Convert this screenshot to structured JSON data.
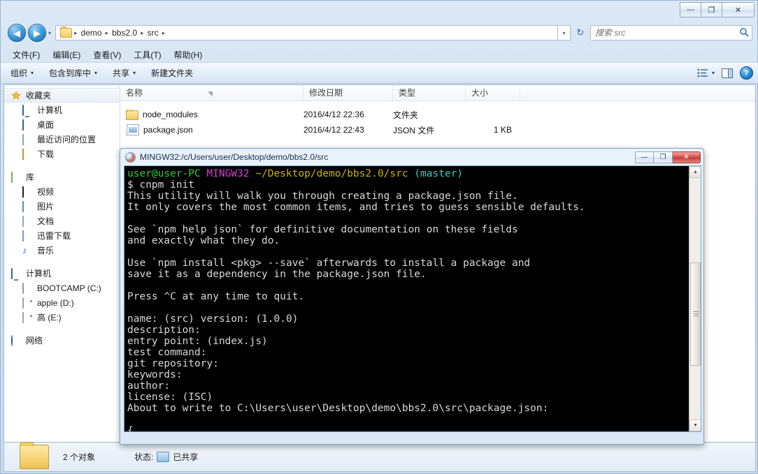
{
  "window": {
    "controls": {
      "minimize": "—",
      "maximize": "❐",
      "close": "✕"
    }
  },
  "address_bar": {
    "back_label": "◀",
    "forward_label": "▶",
    "history_dropdown": "▾",
    "breadcrumbs": [
      "demo",
      "bbs2.0",
      "src"
    ],
    "separator": "▸",
    "path_dropdown": "▾",
    "refresh_label": "↻"
  },
  "search": {
    "placeholder": "搜索 src",
    "value": "",
    "icon": "search-icon"
  },
  "menu": {
    "items": [
      "文件(F)",
      "编辑(E)",
      "查看(V)",
      "工具(T)",
      "帮助(H)"
    ]
  },
  "toolbar": {
    "items": [
      {
        "label": "组织",
        "caret": "▾"
      },
      {
        "label": "包含到库中",
        "caret": "▾"
      },
      {
        "label": "共享",
        "caret": "▾"
      },
      {
        "label": "新建文件夹",
        "caret": ""
      }
    ],
    "view_caret": "▾",
    "help_label": "?"
  },
  "nav_pane": {
    "groups": [
      {
        "header": {
          "label": "收藏夹",
          "icon": "star-icon",
          "selected": true
        },
        "items": [
          {
            "label": "计算机",
            "icon": "computer-icon"
          },
          {
            "label": "桌面",
            "icon": "desktop-icon"
          },
          {
            "label": "最近访问的位置",
            "icon": "recent-places-icon"
          },
          {
            "label": "下载",
            "icon": "downloads-icon"
          }
        ]
      },
      {
        "header": {
          "label": "库",
          "icon": "library-icon",
          "selected": false
        },
        "items": [
          {
            "label": "视频",
            "icon": "video-icon"
          },
          {
            "label": "图片",
            "icon": "pictures-icon"
          },
          {
            "label": "文档",
            "icon": "documents-icon"
          },
          {
            "label": "迅雷下载",
            "icon": "thunder-download-icon"
          },
          {
            "label": "音乐",
            "icon": "music-icon"
          }
        ]
      },
      {
        "header": {
          "label": "计算机",
          "icon": "computer-icon",
          "selected": false
        },
        "items": [
          {
            "label": "BOOTCAMP (C:)",
            "icon": "hard-drive-icon"
          },
          {
            "label": "apple (D:)",
            "icon": "drive-icon"
          },
          {
            "label": "高 (E:)",
            "icon": "drive-icon"
          }
        ]
      },
      {
        "header": {
          "label": "网络",
          "icon": "network-icon",
          "selected": false
        },
        "items": []
      }
    ]
  },
  "file_list": {
    "columns": [
      "名称",
      "修改日期",
      "类型",
      "大小"
    ],
    "rows": [
      {
        "name": "node_modules",
        "date": "2016/4/12 22:36",
        "type": "文件夹",
        "size": "",
        "icon": "folder-icon"
      },
      {
        "name": "package.json",
        "date": "2016/4/12 22:43",
        "type": "JSON 文件",
        "size": "1 KB",
        "icon": "json-file-icon"
      }
    ]
  },
  "details_pane": {
    "object_count": "2 个对象",
    "status_label": "状态:",
    "status_value": "已共享"
  },
  "terminal": {
    "title": "MINGW32:/c/Users/user/Desktop/demo/bbs2.0/src",
    "controls": {
      "minimize": "—",
      "maximize": "❐",
      "close": "✕"
    },
    "prompt": {
      "user": "user@user-PC",
      "shell": "MINGW32",
      "path": "~/Desktop/demo/bbs2.0/src",
      "branch": "(master)"
    },
    "lines": [
      "$ cnpm init",
      "This utility will walk you through creating a package.json file.",
      "It only covers the most common items, and tries to guess sensible defaults.",
      "",
      "See `npm help json` for definitive documentation on these fields",
      "and exactly what they do.",
      "",
      "Use `npm install <pkg> --save` afterwards to install a package and",
      "save it as a dependency in the package.json file.",
      "",
      "Press ^C at any time to quit.",
      "",
      "name: (src) version: (1.0.0)",
      "description:",
      "entry point: (index.js)",
      "test command:",
      "git repository:",
      "keywords:",
      "author:",
      "license: (ISC)",
      "About to write to C:\\Users\\user\\Desktop\\demo\\bbs2.0\\src\\package.json:",
      "",
      "{"
    ],
    "scrollbar": {
      "up": "▲",
      "down": "▼"
    }
  },
  "colors": {
    "prompt_user": "#2ecc40",
    "prompt_shell": "#d63fd6",
    "prompt_path": "#c8b400",
    "prompt_branch": "#39c9c9",
    "terminal_bg": "#000000",
    "terminal_fg": "#d8d8d8",
    "accent": "#2a6ca8"
  }
}
